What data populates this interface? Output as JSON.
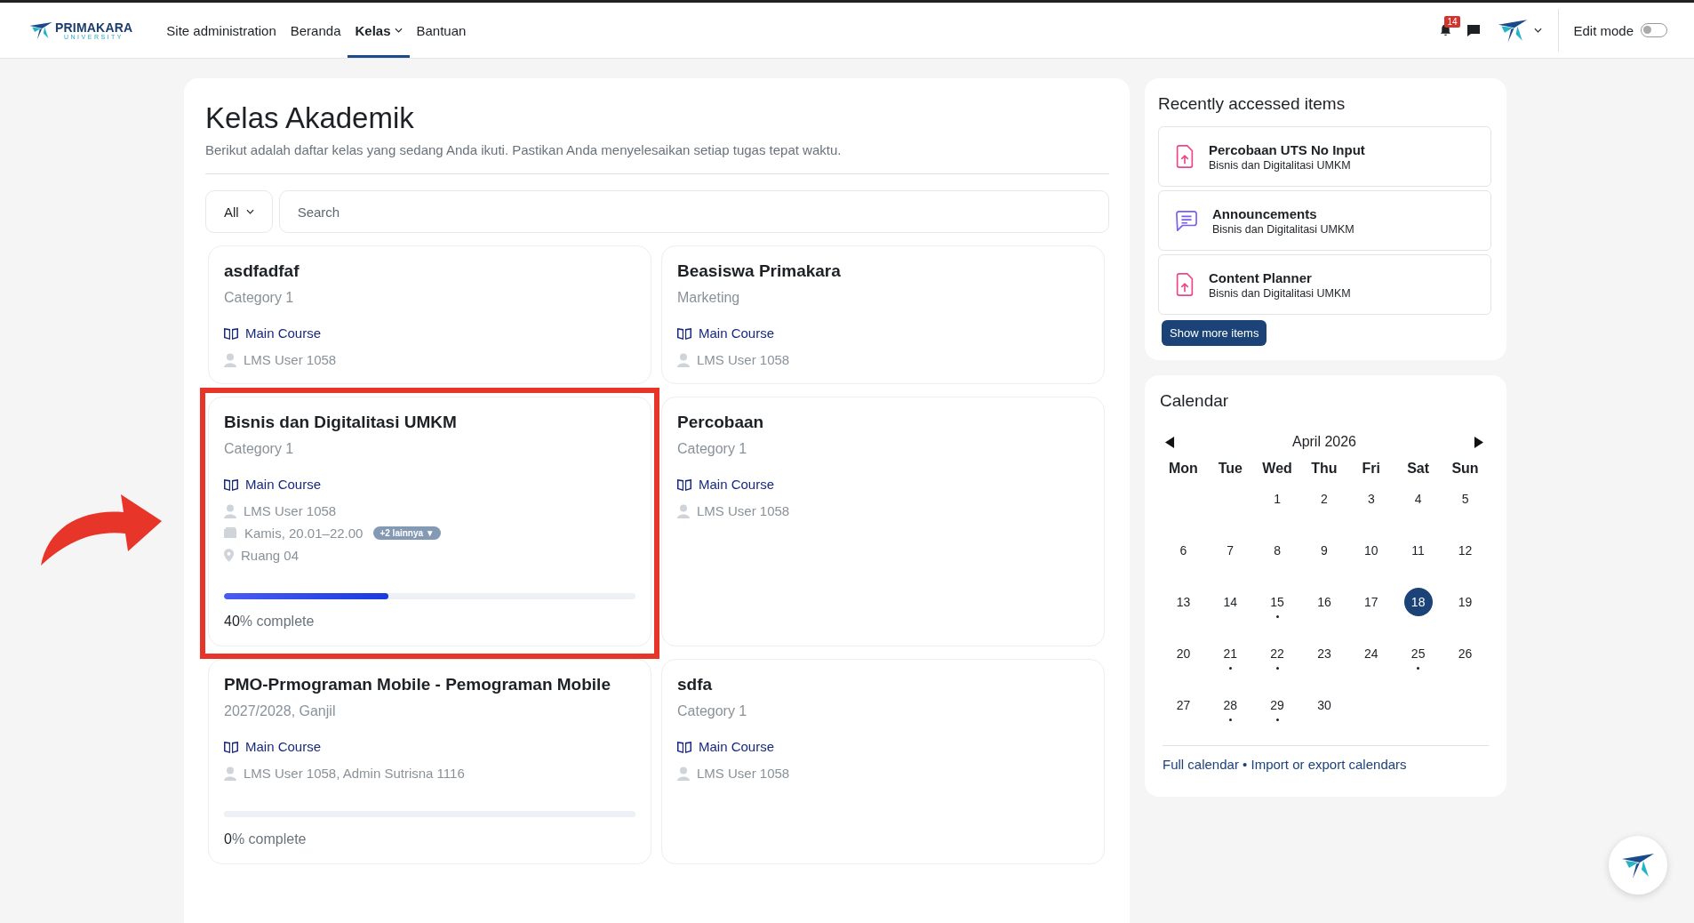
{
  "header": {
    "logo": {
      "name": "PRIMAKARA",
      "tagline": "UNIVERSITY"
    },
    "nav": [
      {
        "label": "Site administration",
        "selected": false,
        "dropdown": false
      },
      {
        "label": "Beranda",
        "selected": false,
        "dropdown": false
      },
      {
        "label": "Kelas",
        "selected": true,
        "dropdown": true
      },
      {
        "label": "Bantuan",
        "selected": false,
        "dropdown": false
      }
    ],
    "notifications": "14",
    "edit_mode": {
      "label": "Edit mode",
      "on": false
    }
  },
  "main": {
    "title": "Kelas Akademik",
    "subtitle": "Berikut adalah daftar kelas yang sedang Anda ikuti. Pastikan Anda menyelesaikan setiap tugas tepat waktu.",
    "filter": "All",
    "search": {
      "placeholder": "Search"
    }
  },
  "courses": [
    {
      "name": "asdfadfaf",
      "category": "Category 1",
      "type": "Main Course",
      "teachers": "LMS User 1058",
      "highlighted": false
    },
    {
      "name": "Beasiswa Primakara",
      "category": "Marketing",
      "type": "Main Course",
      "teachers": "LMS User 1058",
      "highlighted": false
    },
    {
      "name": "Bisnis dan Digitalitasi UMKM",
      "category": "Category 1",
      "type": "Main Course",
      "teachers": "LMS User 1058",
      "schedule": "Kamis, 20.01–22.00",
      "schedule_more": "+2 lainnya ▼",
      "room": "Ruang 04",
      "level": 0.4,
      "percent": "40",
      "progress_suffix": "% complete",
      "highlighted": true
    },
    {
      "name": "Percobaan",
      "category": "Category 1",
      "type": "Main Course",
      "teachers": "LMS User 1058",
      "highlighted": false
    },
    {
      "name": "PMO-Prmograman Mobile - Pemograman Mobile",
      "category": "2027/2028, Ganjil",
      "type": "Main Course",
      "teachers": "LMS User 1058, Admin Sutrisna 1116",
      "level": 0,
      "percent": "0",
      "progress_suffix": "% complete",
      "highlighted": false
    },
    {
      "name": "sdfa",
      "category": "Category 1",
      "type": "Main Course",
      "teachers": "LMS User 1058",
      "highlighted": false
    }
  ],
  "recent": {
    "title": "Recently accessed items",
    "items": [
      {
        "kind": "assignment",
        "title": "Percobaan UTS No Input",
        "course": "Bisnis dan Digitalitasi UMKM"
      },
      {
        "kind": "forum",
        "title": "Announcements",
        "course": "Bisnis dan Digitalitasi UMKM"
      },
      {
        "kind": "assignment",
        "title": "Content Planner",
        "course": "Bisnis dan Digitalitasi UMKM"
      }
    ],
    "button": "Show more items"
  },
  "calendar": {
    "title": "Calendar",
    "month": "April 2026",
    "weekdays": [
      "Mon",
      "Tue",
      "Wed",
      "Thu",
      "Fri",
      "Sat",
      "Sun"
    ],
    "weeks": [
      {
        "pad_before": true,
        "days": [
          {
            "day": "1",
            "today": false,
            "event": false
          },
          {
            "day": "2",
            "today": false,
            "event": false
          },
          {
            "day": "3",
            "today": false,
            "event": false
          },
          {
            "day": "4",
            "today": false,
            "event": false
          },
          {
            "day": "5",
            "today": false,
            "event": false
          }
        ]
      },
      {
        "days": [
          {
            "day": "6",
            "today": false,
            "event": false
          },
          {
            "day": "7",
            "today": false,
            "event": false
          },
          {
            "day": "8",
            "today": false,
            "event": false
          },
          {
            "day": "9",
            "today": false,
            "event": false
          },
          {
            "day": "10",
            "today": false,
            "event": false
          },
          {
            "day": "11",
            "today": false,
            "event": false
          },
          {
            "day": "12",
            "today": false,
            "event": false
          }
        ]
      },
      {
        "days": [
          {
            "day": "13",
            "today": false,
            "event": false
          },
          {
            "day": "14",
            "today": false,
            "event": false
          },
          {
            "day": "15",
            "today": false,
            "event": true
          },
          {
            "day": "16",
            "today": false,
            "event": false
          },
          {
            "day": "17",
            "today": false,
            "event": false
          },
          {
            "day": "18",
            "today": true,
            "event": false
          },
          {
            "day": "19",
            "today": false,
            "event": false
          }
        ]
      },
      {
        "days": [
          {
            "day": "20",
            "today": false,
            "event": false
          },
          {
            "day": "21",
            "today": false,
            "event": true
          },
          {
            "day": "22",
            "today": false,
            "event": true
          },
          {
            "day": "23",
            "today": false,
            "event": false
          },
          {
            "day": "24",
            "today": false,
            "event": false
          },
          {
            "day": "25",
            "today": false,
            "event": true
          },
          {
            "day": "26",
            "today": false,
            "event": false
          }
        ]
      },
      {
        "days": [
          {
            "day": "27",
            "today": false,
            "event": false
          },
          {
            "day": "28",
            "today": false,
            "event": true
          },
          {
            "day": "29",
            "today": false,
            "event": true
          },
          {
            "day": "30",
            "today": false,
            "event": false
          }
        ]
      }
    ],
    "links": [
      "Full calendar",
      "Import or export calendars"
    ],
    "separator": "•"
  }
}
